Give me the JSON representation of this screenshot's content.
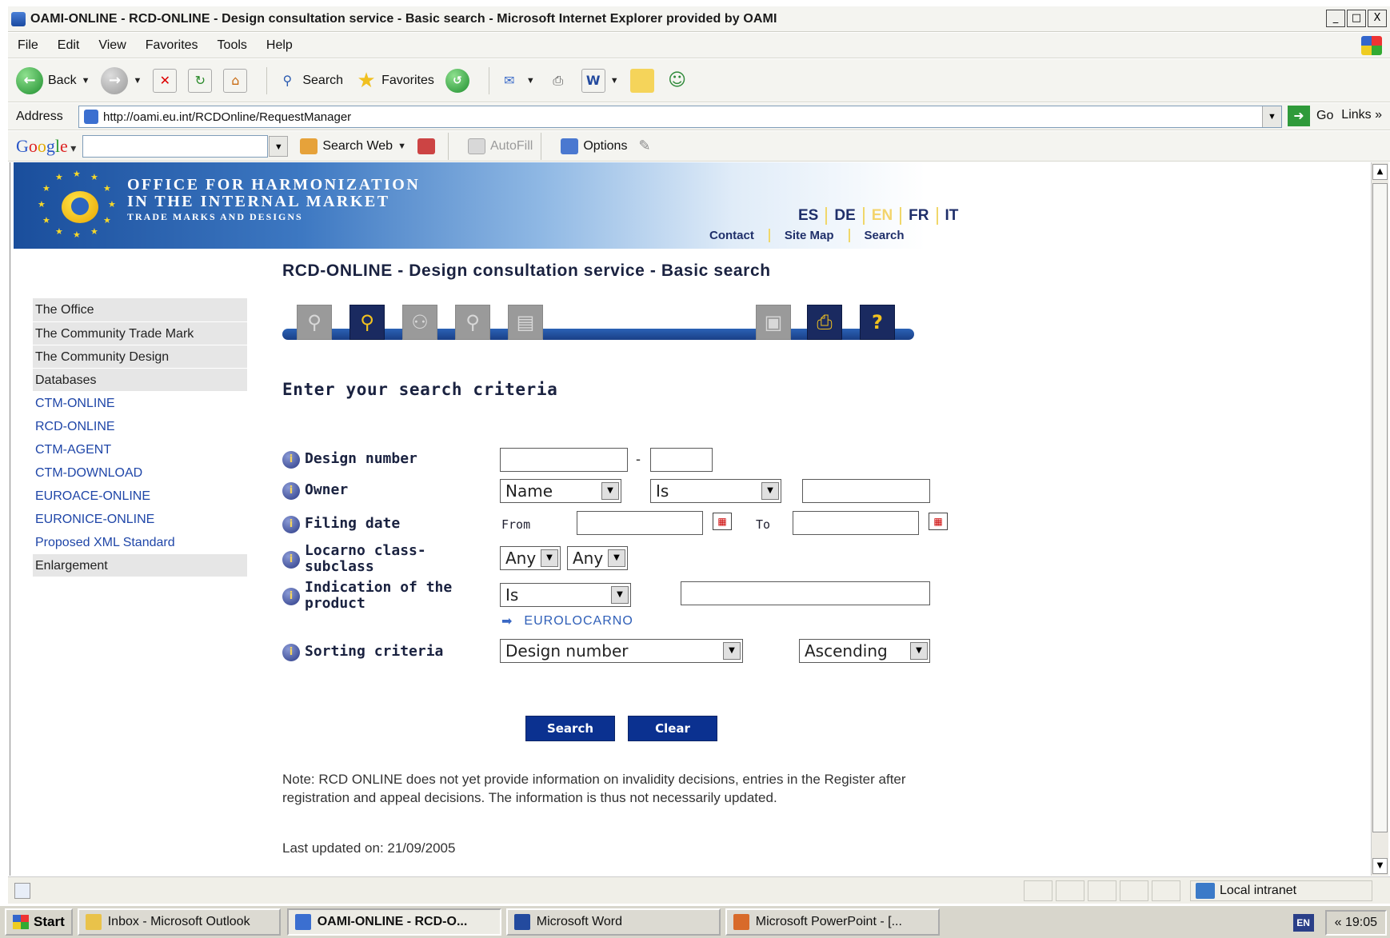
{
  "window": {
    "title": "OAMI-ONLINE - RCD-ONLINE - Design consultation service - Basic search - Microsoft Internet Explorer provided by OAMI",
    "minimize": "_",
    "maximize": "□",
    "close": "X"
  },
  "menu": [
    "File",
    "Edit",
    "View",
    "Favorites",
    "Tools",
    "Help"
  ],
  "toolbar": {
    "back_label": "Back",
    "search_label": "Search",
    "favorites_label": "Favorites"
  },
  "address": {
    "label": "Address",
    "url": "http://oami.eu.int/RCDOnline/RequestManager",
    "go_label": "Go",
    "links_label": "Links »"
  },
  "googlebar": {
    "search_web": "Search Web",
    "autofill": "AutoFill",
    "options": "Options"
  },
  "site": {
    "org_line1": "OFFICE FOR HARMONIZATION",
    "org_line2": "IN THE INTERNAL MARKET",
    "org_line3": "TRADE MARKS AND DESIGNS",
    "languages": [
      "ES",
      "DE",
      "EN",
      "FR",
      "IT"
    ],
    "active_language": "EN",
    "top_links": [
      "Contact",
      "Site Map",
      "Search"
    ]
  },
  "sidebar": {
    "items": [
      {
        "label": "The Office",
        "style": "grey"
      },
      {
        "label": "The Community Trade Mark",
        "style": "grey"
      },
      {
        "label": "The Community Design",
        "style": "grey"
      },
      {
        "label": "Databases",
        "style": "grey"
      },
      {
        "label": "CTM-ONLINE",
        "style": "link"
      },
      {
        "label": "RCD-ONLINE",
        "style": "link"
      },
      {
        "label": "CTM-AGENT",
        "style": "link"
      },
      {
        "label": "CTM-DOWNLOAD",
        "style": "link"
      },
      {
        "label": "EUROACE-ONLINE",
        "style": "link"
      },
      {
        "label": "EURONICE-ONLINE",
        "style": "link"
      },
      {
        "label": "Proposed XML Standard",
        "style": "link"
      },
      {
        "label": "Enlargement",
        "style": "grey"
      }
    ]
  },
  "main": {
    "page_title": "RCD-ONLINE - Design consultation service - Basic search",
    "section_title": "Enter your search criteria",
    "criteria": {
      "design_number": {
        "label": "Design number",
        "part1": "",
        "separator": "-",
        "part2": ""
      },
      "owner": {
        "label": "Owner",
        "field": "Name",
        "operator": "Is",
        "value": ""
      },
      "filing_date": {
        "label": "Filing date",
        "from_label": "From",
        "to_label": "To",
        "from": "",
        "to": ""
      },
      "locarno": {
        "label_line1": "Locarno class-",
        "label_line2": "subclass",
        "class": "Any",
        "subclass": "Any"
      },
      "indication": {
        "label_line1": "Indication of the",
        "label_line2": "product",
        "operator": "Is",
        "value": "",
        "eurolocarno_link": "EUROLOCARNO"
      },
      "sorting": {
        "label": "Sorting criteria",
        "field": "Design number",
        "order": "Ascending"
      }
    },
    "search_button": "Search",
    "clear_button": "Clear",
    "note": "Note: RCD ONLINE does not yet provide information on invalidity decisions, entries in the Register after registration and appeal decisions. The information is thus not necessarily updated.",
    "last_updated": "Last updated on: 21/09/2005"
  },
  "statusbar": {
    "zone": "Local intranet"
  },
  "taskbar": {
    "start": "Start",
    "tasks": [
      {
        "label": "Inbox - Microsoft Outlook",
        "active": false
      },
      {
        "label": "OAMI-ONLINE - RCD-O...",
        "active": true
      },
      {
        "label": "Microsoft Word",
        "active": false
      },
      {
        "label": "Microsoft PowerPoint - [...",
        "active": false
      }
    ],
    "lang_indicator": "EN",
    "clock": "« 19:05"
  }
}
